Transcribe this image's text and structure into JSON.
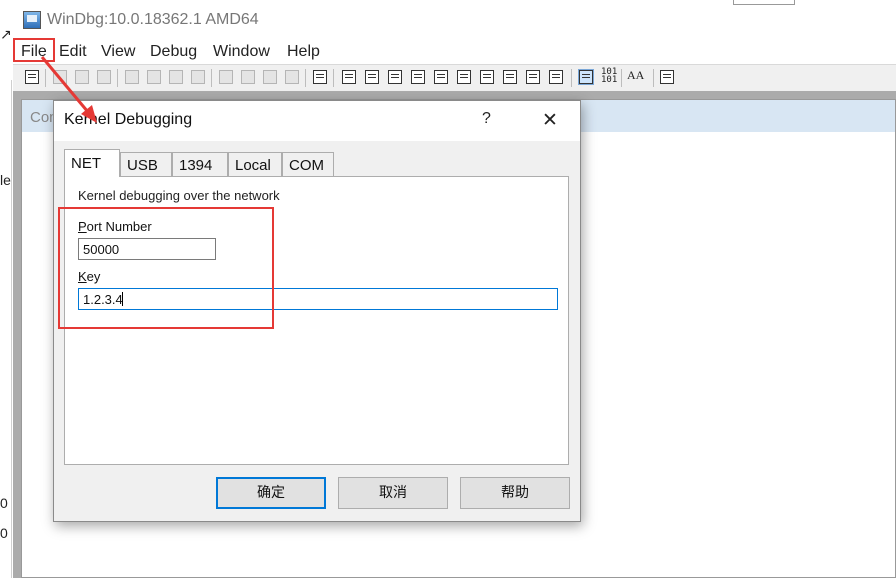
{
  "background_fragments": {
    "top": "↗",
    "middle": "le",
    "lower1": "0",
    "lower2": "0"
  },
  "window": {
    "title": "WinDbg:10.0.18362.1 AMD64"
  },
  "menubar": {
    "items": [
      "File",
      "Edit",
      "View",
      "Debug",
      "Window",
      "Help"
    ]
  },
  "mdi": {
    "child_title": "Com"
  },
  "dialog": {
    "title": "Kernel Debugging",
    "help_glyph": "?",
    "close_glyph": "✕",
    "tabs": [
      "NET",
      "USB",
      "1394",
      "Local",
      "COM"
    ],
    "active_tab": "NET",
    "description": "Kernel debugging over the network",
    "port_label_prefix": "P",
    "port_label_rest": "ort Number",
    "port_value": "50000",
    "key_label_prefix": "K",
    "key_label_rest": "ey",
    "key_value": "1.2.3.4",
    "buttons": {
      "ok": "确定",
      "cancel": "取消",
      "help": "帮助"
    }
  },
  "toolbar": {
    "binary_text": "101\n101",
    "font_text": "AA"
  },
  "colors": {
    "annotation": "#e53935",
    "focus": "#0078d7"
  }
}
